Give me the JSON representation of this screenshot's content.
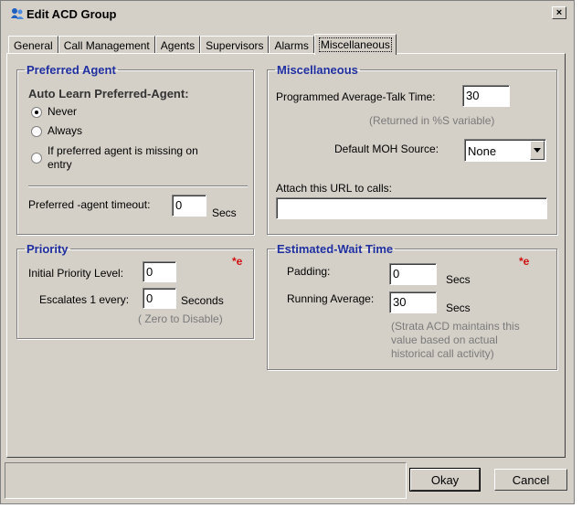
{
  "window": {
    "title": "Edit ACD Group",
    "close_glyph": "×"
  },
  "tabs": [
    {
      "label": "General"
    },
    {
      "label": "Call Management"
    },
    {
      "label": "Agents"
    },
    {
      "label": "Supervisors"
    },
    {
      "label": "Alarms"
    },
    {
      "label": "Miscellaneous",
      "active": true
    }
  ],
  "preferred_agent": {
    "legend": "Preferred Agent",
    "heading": "Auto Learn Preferred-Agent:",
    "options": [
      "Never",
      "Always",
      "If preferred agent is missing on",
      "entry"
    ],
    "selected": "Never",
    "timeout_label": "Preferred -agent timeout:",
    "timeout_value": "0",
    "timeout_unit": "Secs"
  },
  "priority": {
    "legend": "Priority",
    "required_mark": "*e",
    "initial_label": "Initial Priority Level:",
    "initial_value": "0",
    "escalates_label": "Escalates 1 every:",
    "escalates_value": "0",
    "escalates_unit": "Seconds",
    "hint": "( Zero to Disable)"
  },
  "miscellaneous": {
    "legend": "Miscellaneous",
    "talk_time_label": "Programmed Average-Talk Time:",
    "talk_time_value": "30",
    "talk_time_hint": "(Returned in %S variable)",
    "moh_label": "Default MOH Source:",
    "moh_value": "None",
    "url_label": "Attach this URL to calls:",
    "url_value": ""
  },
  "estimated_wait": {
    "legend": "Estimated-Wait Time",
    "required_mark": "*e",
    "padding_label": "Padding:",
    "padding_value": "0",
    "padding_unit": "Secs",
    "running_label": "Running Average:",
    "running_value": "30",
    "running_unit": "Secs",
    "note": [
      "(Strata ACD maintains this",
      "value based on actual",
      "historical call activity)"
    ]
  },
  "buttons": {
    "okay": "Okay",
    "cancel": "Cancel"
  },
  "icons": {
    "title": "acd-group-icon",
    "dropdown": "chevron-down-icon",
    "close": "close-icon"
  }
}
